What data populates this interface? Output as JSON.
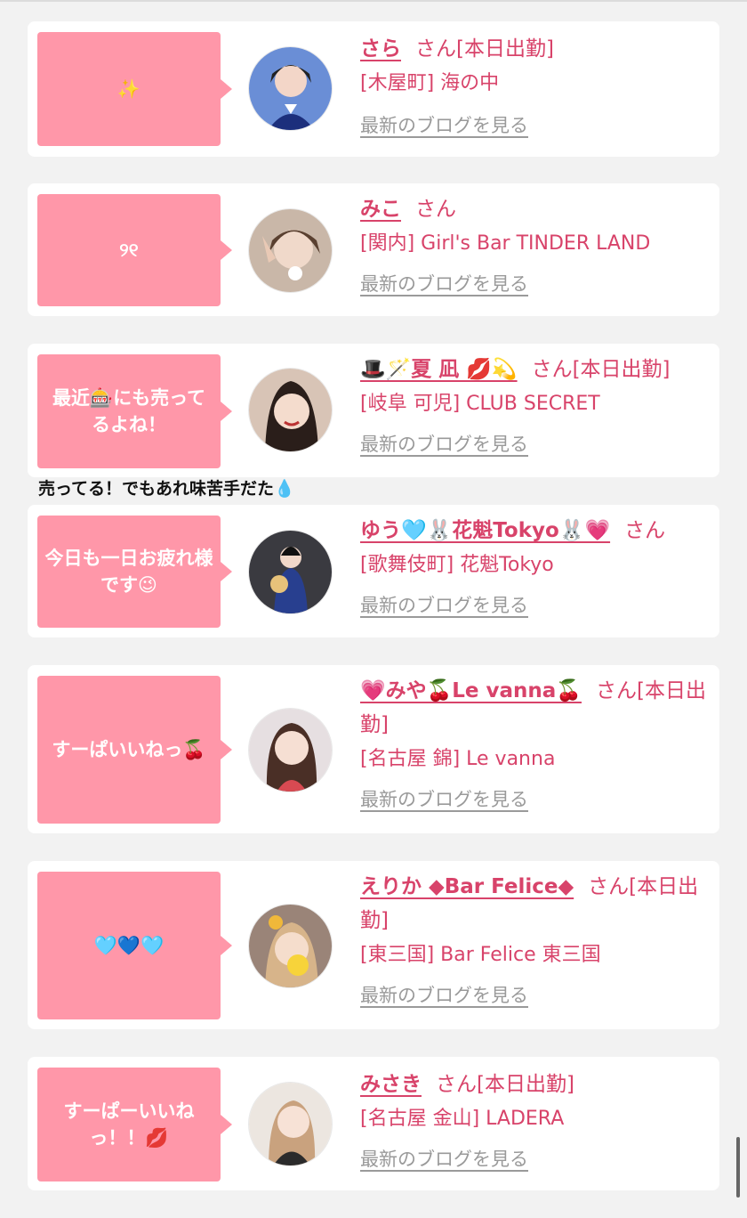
{
  "comment_reply": "売ってる！でもあれ味苦手だた💧",
  "san_suffix": "さん",
  "blog_link_label": "最新のブログを見る",
  "cards": [
    {
      "comment": "✨",
      "name": "さら",
      "status": "[本日出勤]",
      "shop": "[木屋町] 海の中"
    },
    {
      "comment": "୨୧",
      "name": "みこ",
      "status": "",
      "shop": "[関内] Girl's Bar TINDER LAND"
    },
    {
      "comment": "最近🎰にも売ってるよね！",
      "name": "🎩🪄夏 凪 💋💫",
      "status": "[本日出勤]",
      "shop": "[岐阜 可児] CLUB SECRET"
    },
    {
      "comment": "今日も一日お疲れ様です😉",
      "name": "ゆう🩵🐰花魁Tokyo🐰💗",
      "status": "",
      "shop": "[歌舞伎町] 花魁Tokyo"
    },
    {
      "comment": "すーぱいいねっ🍒",
      "name": "💗みや🍒Le vanna🍒",
      "status": "[本日出勤]",
      "shop": "[名古屋 錦] Le vanna"
    },
    {
      "comment": "🩵💙🩵",
      "name": "えりか ◆Bar Felice◆",
      "status": "[本日出勤]",
      "shop": "[東三国] Bar Felice 東三国"
    },
    {
      "comment": "すーぱーいいねっ！！💋",
      "name": "みさき",
      "status": "[本日出勤]",
      "shop": "[名古屋 金山] LADERA"
    }
  ],
  "colors": {
    "bubble": "#ff97a9",
    "accent": "#d8436a",
    "link_gray": "#9a9a9a",
    "background": "#f2f2f2"
  }
}
